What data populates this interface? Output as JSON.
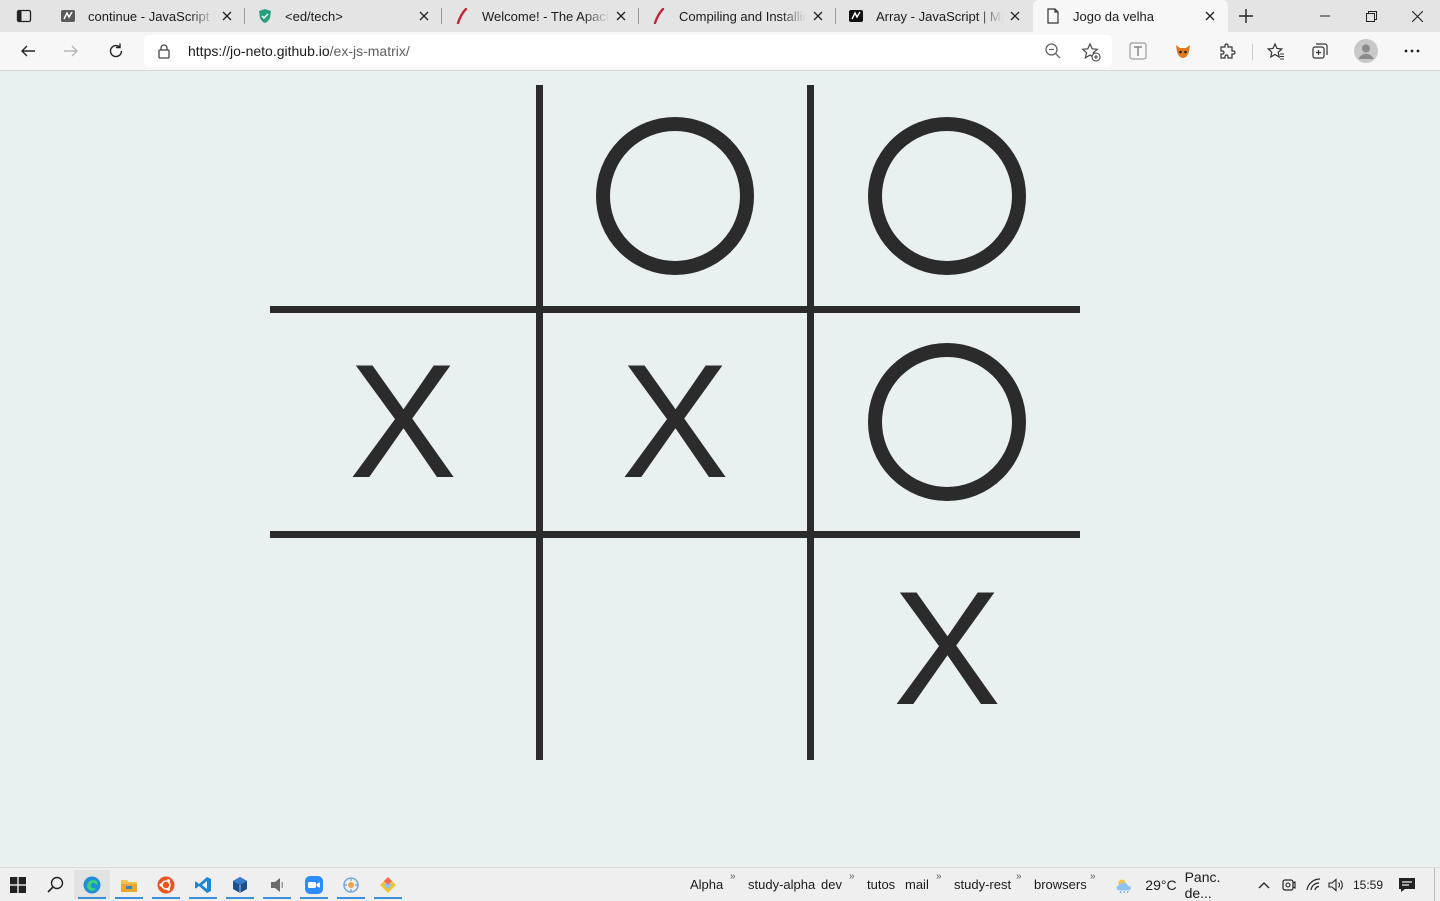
{
  "browser": {
    "tabs": [
      {
        "title": "continue - JavaScript | MDN",
        "icon": "mdn-icon",
        "active": false
      },
      {
        "title": "<ed/tech>",
        "icon": "shield-icon",
        "active": false
      },
      {
        "title": "Welcome! - The Apache HTTP Server",
        "icon": "apache-feather-icon",
        "active": false
      },
      {
        "title": "Compiling and Installing - Apache",
        "icon": "apache-feather-icon",
        "active": false
      },
      {
        "title": "Array - JavaScript | MDN",
        "icon": "mdn-icon",
        "active": false
      },
      {
        "title": "Jogo da velha",
        "icon": "page-icon",
        "active": true
      }
    ],
    "address": {
      "host": "https://jo-neto.github.io",
      "path": "/ex-js-matrix/"
    }
  },
  "game": {
    "title": "Jogo da velha",
    "board": [
      [
        "",
        "O",
        "O"
      ],
      [
        "X",
        "X",
        "O"
      ],
      [
        "",
        "",
        "X"
      ]
    ]
  },
  "taskbar": {
    "pinned": [
      "windows-icon",
      "search-icon",
      "edge-icon",
      "file-explorer-icon",
      "ubuntu-icon",
      "vscode-icon",
      "virtualbox-icon",
      "audio-app-icon",
      "zoom-icon",
      "app-icon",
      "git-icon"
    ],
    "toolbars": [
      {
        "label": "Alpha",
        "chevron": true
      },
      {
        "label": "study-alpha",
        "chevron": false
      },
      {
        "label": "dev",
        "chevron": true
      },
      {
        "label": "tutos",
        "chevron": false
      },
      {
        "label": "mail",
        "chevron": true
      },
      {
        "label": "study-rest",
        "chevron": true
      },
      {
        "label": "browsers",
        "chevron": true
      }
    ],
    "weather": {
      "temp": "29°C",
      "text": "Panc. de..."
    },
    "clock": "15:59",
    "chevron_glyph": "»"
  }
}
